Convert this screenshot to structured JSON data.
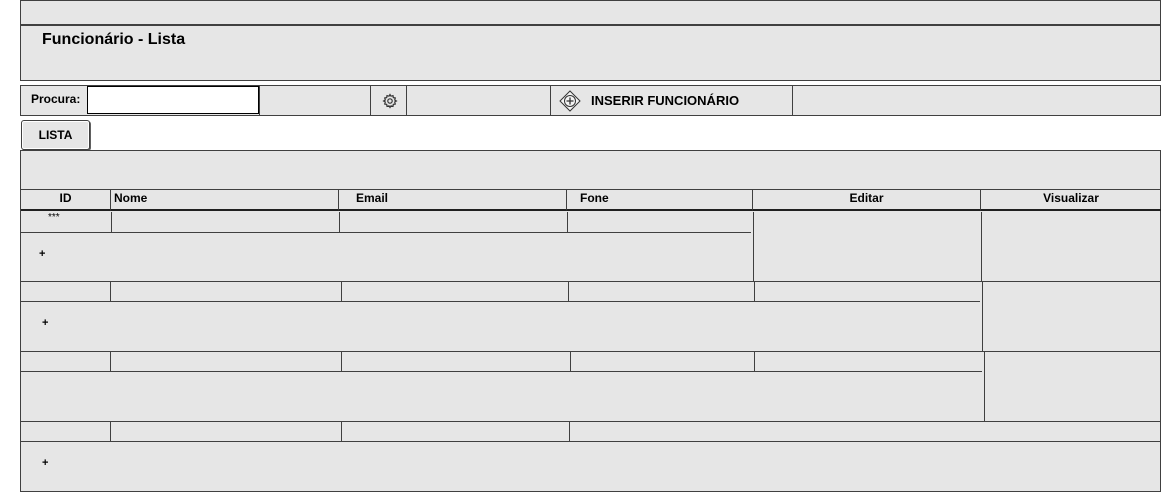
{
  "header": {
    "title": "Funcionário - Lista"
  },
  "toolbar": {
    "search_label": "Procura:",
    "search_value": "",
    "insert_label": "INSERIR FUNCIONÁRIO"
  },
  "tabs": [
    {
      "label": "LISTA"
    }
  ],
  "table": {
    "columns": [
      "ID",
      "Nome",
      "Email",
      "Fone",
      "Editar",
      "Visualizar"
    ],
    "first_row_marker": "***",
    "expand_symbol": "+"
  }
}
